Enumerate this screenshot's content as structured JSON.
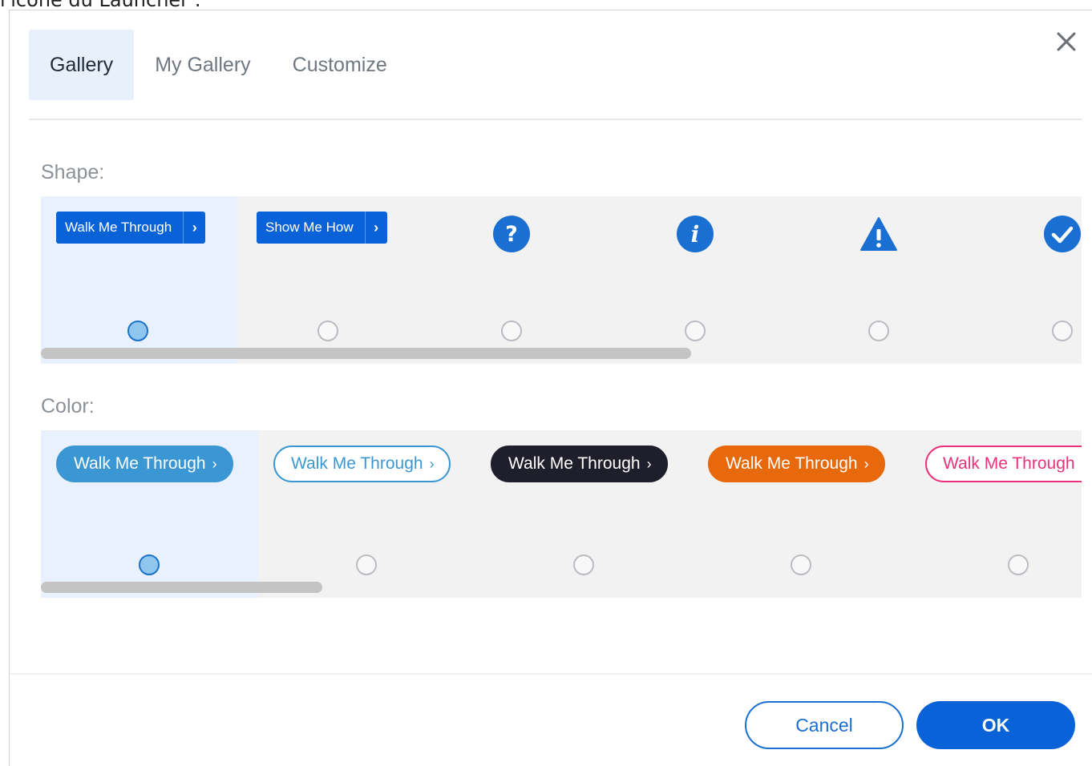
{
  "background_caption": "l'icône du Launcher :",
  "tabs": [
    {
      "label": "Gallery",
      "active": true
    },
    {
      "label": "My Gallery",
      "active": false
    },
    {
      "label": "Customize",
      "active": false
    }
  ],
  "close_icon": "close-icon",
  "shape_section": {
    "label": "Shape:",
    "buttons": [
      {
        "label": "Walk Me Through",
        "chevron": "›"
      },
      {
        "label": "Show Me How",
        "chevron": "›"
      }
    ],
    "icons": [
      "question-circle-icon",
      "info-circle-icon",
      "warning-triangle-icon",
      "check-circle-icon"
    ],
    "selected_index": 0
  },
  "color_section": {
    "label": "Color:",
    "swatches": [
      {
        "label": "Walk Me Through",
        "chevron": "›",
        "style": "solid",
        "bg": "#3b97d3",
        "fg": "#ffffff",
        "border": "#3b97d3"
      },
      {
        "label": "Walk Me Through",
        "chevron": "›",
        "style": "outline",
        "bg": "#ffffff",
        "fg": "#3b97d3",
        "border": "#3b97d3"
      },
      {
        "label": "Walk Me Through",
        "chevron": "›",
        "style": "solid",
        "bg": "#1f1e2b",
        "fg": "#ffffff",
        "border": "#1f1e2b"
      },
      {
        "label": "Walk Me Through",
        "chevron": "›",
        "style": "solid",
        "bg": "#e8690c",
        "fg": "#ffffff",
        "border": "#e8690c"
      },
      {
        "label": "Walk Me Through",
        "chevron": "›",
        "style": "outline",
        "bg": "#ffffff",
        "fg": "#e8337a",
        "border": "#e8337a"
      }
    ],
    "selected_index": 0
  },
  "colors": {
    "accent": "#0a62d9",
    "icon_blue": "#1a6fd3"
  },
  "footer": {
    "cancel_label": "Cancel",
    "ok_label": "OK"
  }
}
